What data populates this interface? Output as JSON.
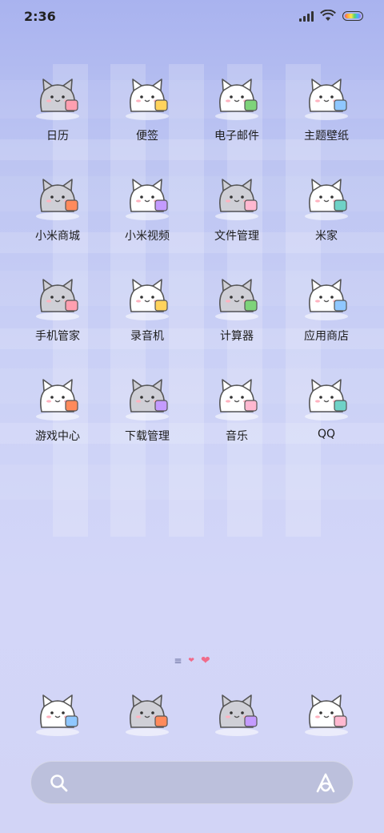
{
  "status_bar": {
    "time": "2:36",
    "icons": [
      "signal-icon",
      "wifi-icon",
      "battery-icon"
    ]
  },
  "apps": [
    {
      "label": "日历",
      "icon": "cat-calendar-icon"
    },
    {
      "label": "便签",
      "icon": "cat-notes-icon"
    },
    {
      "label": "电子邮件",
      "icon": "cat-email-icon"
    },
    {
      "label": "主题壁纸",
      "icon": "cat-themes-icon"
    },
    {
      "label": "小米商城",
      "icon": "cat-store-icon"
    },
    {
      "label": "小米视频",
      "icon": "cat-video-icon"
    },
    {
      "label": "文件管理",
      "icon": "cat-files-icon"
    },
    {
      "label": "米家",
      "icon": "cat-mijia-icon"
    },
    {
      "label": "手机管家",
      "icon": "cat-security-icon"
    },
    {
      "label": "录音机",
      "icon": "cat-recorder-icon"
    },
    {
      "label": "计算器",
      "icon": "cat-calculator-icon"
    },
    {
      "label": "应用商店",
      "icon": "cat-appstore-icon"
    },
    {
      "label": "游戏中心",
      "icon": "cat-games-icon"
    },
    {
      "label": "下载管理",
      "icon": "cat-downloads-icon"
    },
    {
      "label": "音乐",
      "icon": "cat-music-icon"
    },
    {
      "label": "QQ",
      "icon": "cat-qq-icon"
    }
  ],
  "dock": [
    {
      "icon": "cat-phone-icon"
    },
    {
      "icon": "cat-browser-icon"
    },
    {
      "icon": "cat-messages-icon"
    },
    {
      "icon": "cat-camera-icon"
    }
  ],
  "search_bar": {
    "icons": [
      "search-icon",
      "assistant-icon"
    ]
  },
  "colors": {
    "background_top": "#a9b3ef",
    "background_bottom": "#d2d4f6",
    "heart": "#f06b8a",
    "cat_gray": "#c9c9cf",
    "cat_white": "#ffffff"
  }
}
